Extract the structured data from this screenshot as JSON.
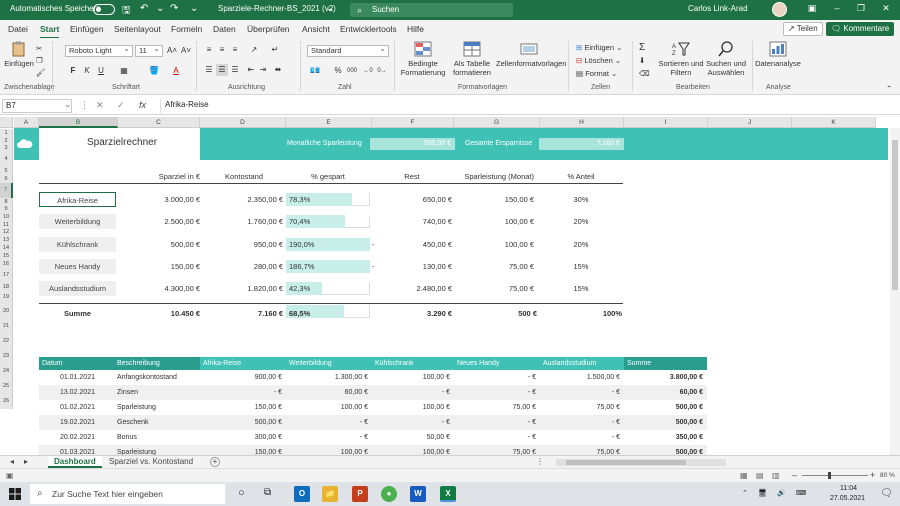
{
  "titlebar": {
    "autosave_label": "Automatisches Speichern",
    "doc_title": "Sparziele-Rechner-BS_2021 (v2)",
    "search_placeholder": "Suchen",
    "user_name": "Carlos Link-Arad"
  },
  "menu": {
    "tabs": [
      "Datei",
      "Start",
      "Einfügen",
      "Seitenlayout",
      "Formeln",
      "Daten",
      "Überprüfen",
      "Ansicht",
      "Entwicklertools",
      "Hilfe"
    ],
    "active": "Start",
    "share_label": "Teilen",
    "comments_label": "Kommentare"
  },
  "ribbon": {
    "paste_label": "Einfügen",
    "font_name": "Roboto Light",
    "font_size": "11",
    "number_format": "Standard",
    "cond_format_label": "Bedingte Formatierung",
    "as_table_label": "Als Tabelle formatieren",
    "cell_styles_label": "Zellenformatvorlagen",
    "insert_label": "Einfügen",
    "delete_label": "Löschen",
    "format_label": "Format",
    "sort_filter_label": "Sortieren und Filtern",
    "find_select_label": "Suchen und Auswählen",
    "analysis_label": "Datenanalyse",
    "groups": [
      "Zwischenablage",
      "Schriftart",
      "Ausrichtung",
      "Zahl",
      "Formatvorlagen",
      "Zellen",
      "Bearbeiten",
      "Analyse"
    ]
  },
  "formula_bar": {
    "name_box": "B7",
    "fx": "fx",
    "content": "Afrika-Reise"
  },
  "columns": [
    "A",
    "B",
    "C",
    "D",
    "E",
    "F",
    "G",
    "H",
    "I",
    "J",
    "K"
  ],
  "selected_column": "B",
  "rows": [
    "1",
    "2",
    "3",
    "4",
    "5",
    "6",
    "7",
    "8",
    "9",
    "10",
    "11",
    "12",
    "13",
    "14",
    "15",
    "16",
    "17",
    "18",
    "19",
    "20",
    "21",
    "22",
    "23",
    "24",
    "25",
    "26"
  ],
  "selected_row": "7",
  "sheet": {
    "title": "Sparzielrechner",
    "monthly_label": "Monatliche Sparleistung",
    "monthly_value": "500,00 €",
    "total_label": "Gesamte Ersparnisse",
    "total_value": "7.160 €",
    "headers": [
      "Sparziel in €",
      "Kontostand",
      "% gespart",
      "Rest",
      "Sparleistung (Monat)",
      "% Anteil"
    ],
    "goals": [
      {
        "name": "Afrika-Reise",
        "target": "3.000,00 €",
        "balance": "2.350,00 €",
        "pct": "78,3%",
        "fraction": 0.783,
        "rest": "650,00 €",
        "monthly": "150,00 €",
        "share": "30%"
      },
      {
        "name": "Weiterbildung",
        "target": "2.500,00 €",
        "balance": "1.760,00 €",
        "pct": "70,4%",
        "fraction": 0.704,
        "rest": "740,00 €",
        "monthly": "100,00 €",
        "share": "20%"
      },
      {
        "name": "Kühlschrank",
        "target": "500,00 €",
        "balance": "950,00 €",
        "pct": "190,0%",
        "fraction": 1.0,
        "rest": "450,00 €",
        "rest_prefix": "-",
        "monthly": "100,00 €",
        "share": "20%"
      },
      {
        "name": "Neues Handy",
        "target": "150,00 €",
        "balance": "280,00 €",
        "pct": "186,7%",
        "fraction": 1.0,
        "rest": "130,00 €",
        "rest_prefix": "-",
        "monthly": "75,00 €",
        "share": "15%"
      },
      {
        "name": "Auslandsstudium",
        "target": "4.300,00 €",
        "balance": "1.820,00 €",
        "pct": "42,3%",
        "fraction": 0.423,
        "rest": "2.480,00 €",
        "monthly": "75,00 €",
        "share": "15%"
      }
    ],
    "sum": {
      "label": "Summe",
      "target": "10.450 €",
      "balance": "7.160 €",
      "pct": "68,5%",
      "fraction": 0.685,
      "rest": "3.290 €",
      "monthly": "500 €",
      "share": "100%"
    }
  },
  "ledger": {
    "headers": [
      "Datum",
      "Beschreibung",
      "Afrika-Reise",
      "Weiterbildung",
      "Kühlschrank",
      "Neues Handy",
      "Auslandsstudium",
      "Summe"
    ],
    "rows": [
      [
        "01.01.2021",
        "Anfangskontostand",
        "900,00 €",
        "1.300,00 €",
        "100,00 €",
        "-   €",
        "1.500,00 €",
        "3.800,00 €"
      ],
      [
        "13.02.2021",
        "Zinsen",
        "-   €",
        "60,00 €",
        "-   €",
        "-   €",
        "-   €",
        "60,00 €"
      ],
      [
        "01.02.2021",
        "Sparleistung",
        "150,00 €",
        "100,00 €",
        "100,00 €",
        "75,00 €",
        "75,00 €",
        "500,00 €"
      ],
      [
        "19.02.2021",
        "Geschenk",
        "500,00 €",
        "-   €",
        "-   €",
        "-   €",
        "-   €",
        "500,00 €"
      ],
      [
        "20.02.2021",
        "Bonus",
        "300,00 €",
        "-   €",
        "50,00 €",
        "-   €",
        "-   €",
        "350,00 €"
      ],
      [
        "01.03.2021",
        "Sparleistung",
        "150,00 €",
        "100,00 €",
        "100,00 €",
        "75,00 €",
        "75,00 €",
        "500,00 €"
      ]
    ]
  },
  "sheet_tabs": {
    "tabs": [
      "Dashboard",
      "Sparziel vs. Kontostand"
    ],
    "active": "Dashboard",
    "add_label": "+"
  },
  "status": {
    "zoom": "80 %"
  },
  "taskbar": {
    "search_placeholder": "Zur Suche Text hier eingeben",
    "time": "11:04",
    "date": "27.05.2021"
  },
  "colors": {
    "excel_green": "#1e7145",
    "teal": "#3fc1b5",
    "teal_dark": "#2a9d8f",
    "teal_light": "#c7eee9"
  }
}
